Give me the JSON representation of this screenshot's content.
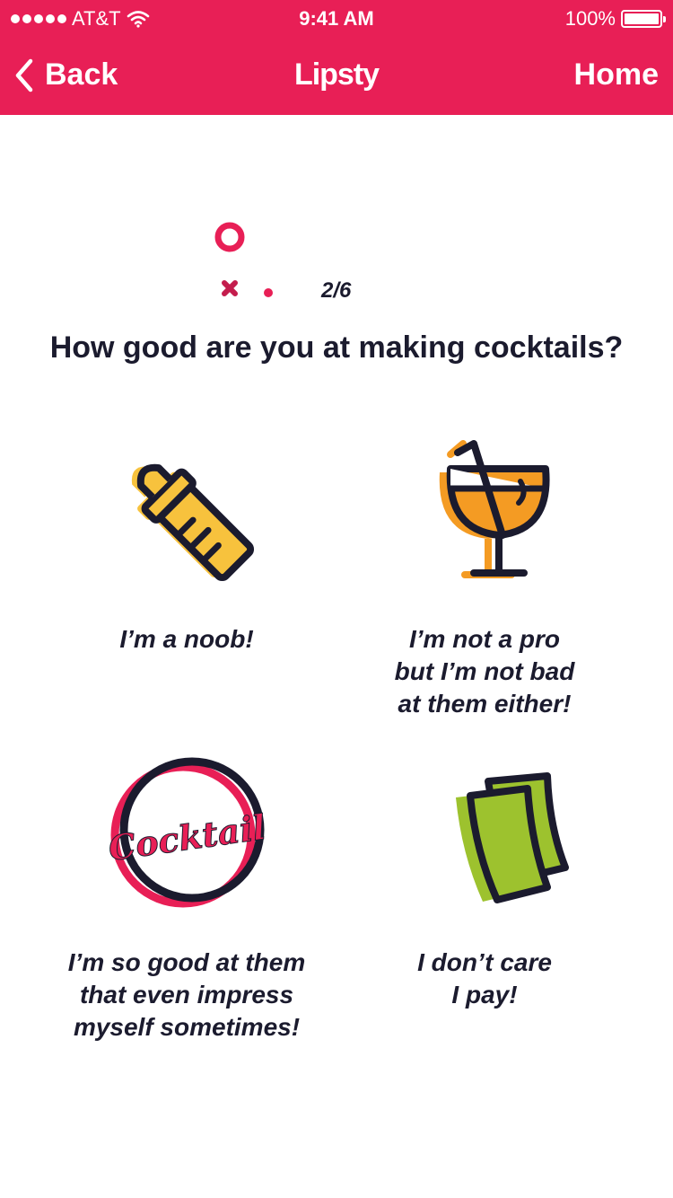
{
  "status_bar": {
    "carrier": "AT&T",
    "time": "9:41 AM",
    "battery": "100%"
  },
  "nav": {
    "back_label": "Back",
    "title": "Lipsty",
    "home_label": "Home"
  },
  "progress": {
    "step_label": "2/6"
  },
  "question": "How good are you at making cocktails?",
  "options": [
    {
      "label": "I’m a noob!",
      "icon": "baby-bottle-icon"
    },
    {
      "label": "I’m not a pro\nbut I’m not bad\nat them either!",
      "icon": "cocktail-glass-icon"
    },
    {
      "label": "I’m so good at them\nthat even impress\nmyself sometimes!",
      "icon": "cocktail-badge-icon",
      "badge_text": "Cocktail"
    },
    {
      "label": "I don’t care\nI pay!",
      "icon": "money-icon"
    }
  ],
  "colors": {
    "brand": "#e81f56",
    "ink": "#1b1b2e",
    "yellow": "#f7c23d",
    "orange": "#f49b23",
    "green": "#9dc22e"
  }
}
